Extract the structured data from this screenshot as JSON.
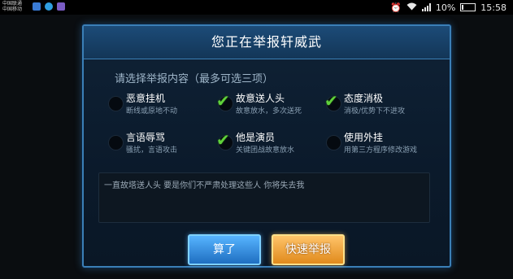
{
  "status_bar": {
    "carrier_line1": "中国联通",
    "carrier_line2": "中国移动",
    "signal_icon": "wifi-icon",
    "battery_pct": "10%",
    "time": "15:58",
    "colors": {
      "app1": "#3a7bd5",
      "app2": "#2f9ee0",
      "app3": "#7a5cc4"
    }
  },
  "dialog": {
    "title": "您正在举报轩威武",
    "section_label": "请选择举报内容（最多可选三项）",
    "options": [
      {
        "label": "恶意挂机",
        "desc": "断线或原地不动",
        "checked": false
      },
      {
        "label": "故意送人头",
        "desc": "故意放水，多次送死",
        "checked": true
      },
      {
        "label": "态度消极",
        "desc": "消极/优势下不进攻",
        "checked": true
      },
      {
        "label": "言语辱骂",
        "desc": "骚扰，言语攻击",
        "checked": false
      },
      {
        "label": "他是演员",
        "desc": "关键团战故意放水",
        "checked": true
      },
      {
        "label": "使用外挂",
        "desc": "用第三方程序修改游戏",
        "checked": false
      }
    ],
    "comment_text": "一直故塔送人头 要是你们不严肃处理这些人 你将失去我",
    "cancel_label": "算了",
    "report_label": "快速举报"
  }
}
